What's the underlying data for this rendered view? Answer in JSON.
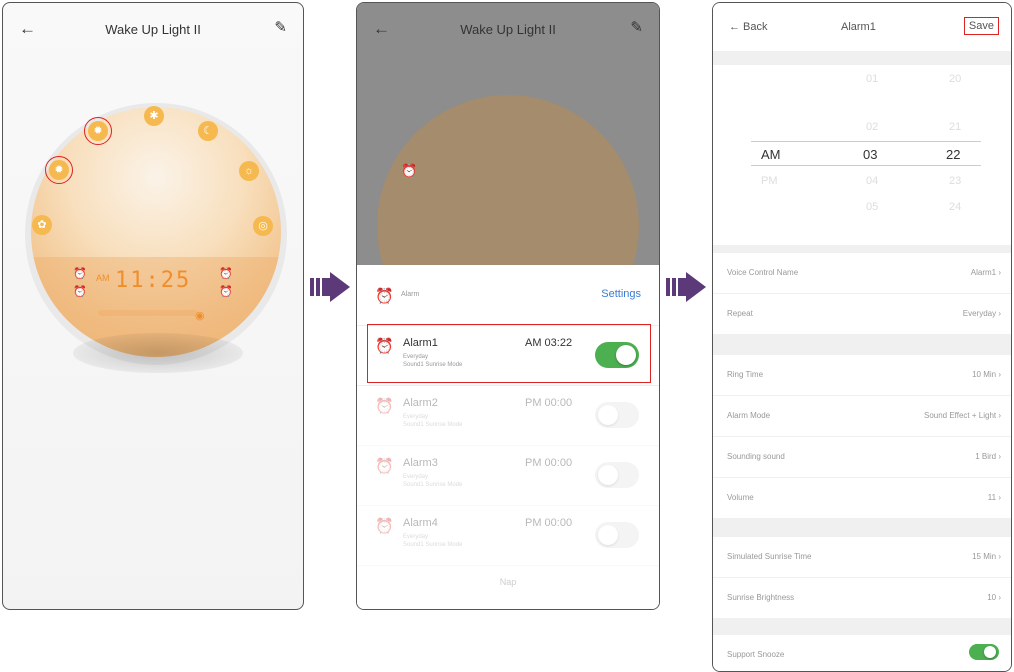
{
  "screen1": {
    "title": "Wake Up Light II",
    "back_icon": "arrow-left-icon",
    "edit_icon": "pencil-icon",
    "clock": {
      "time": "11:25",
      "am": "AM"
    }
  },
  "screen2": {
    "title": "Wake Up Light II",
    "header_label": "Alarm",
    "settings_label": "Settings",
    "alarms": [
      {
        "name": "Alarm1",
        "time": "AM 03:22",
        "repeat": "Everyday",
        "detail": "Sound1  Sunrise Mode",
        "enabled": true
      },
      {
        "name": "Alarm2",
        "time": "PM 00:00",
        "repeat": "Everyday",
        "detail": "Sound1  Sunrise Mode",
        "enabled": false
      },
      {
        "name": "Alarm3",
        "time": "PM 00:00",
        "repeat": "Everyday",
        "detail": "Sound1  Sunrise Mode",
        "enabled": false
      },
      {
        "name": "Alarm4",
        "time": "PM 00:00",
        "repeat": "Everyday",
        "detail": "Sound1  Sunrise Mode",
        "enabled": false
      }
    ],
    "footer": "Nap"
  },
  "screen3": {
    "back_label": "← Back",
    "title": "Alarm1",
    "save_label": "Save",
    "picker": {
      "ampm_selected": "AM",
      "ampm_below": "PM",
      "hour_above": [
        "01",
        "02"
      ],
      "hour_selected": "03",
      "hour_below": [
        "04",
        "05"
      ],
      "minute_above": [
        "20",
        "21"
      ],
      "minute_selected": "22",
      "minute_below": [
        "23",
        "24"
      ]
    },
    "settings": [
      {
        "label": "Voice Control Name",
        "value": "Alarm1 ›"
      },
      {
        "label": "Repeat",
        "value": "Everyday ›"
      },
      {
        "label": "Ring Time",
        "value": "10 Min ›"
      },
      {
        "label": "Alarm Mode",
        "value": "Sound Effect + Light ›"
      },
      {
        "label": "Sounding sound",
        "value": "1 Bird ›"
      },
      {
        "label": "Volume",
        "value": "11 ›"
      },
      {
        "label": "Simulated Sunrise Time",
        "value": "15 Min ›"
      },
      {
        "label": "Sunrise Brightness",
        "value": "10 ›"
      },
      {
        "label": "Support Snooze",
        "value": ""
      }
    ]
  },
  "colors": {
    "accent": "#ef8e2c",
    "toggle_on": "#4caf50",
    "highlight": "#dd2222",
    "arrow": "#5c3a7a",
    "link": "#3a7bd5"
  }
}
